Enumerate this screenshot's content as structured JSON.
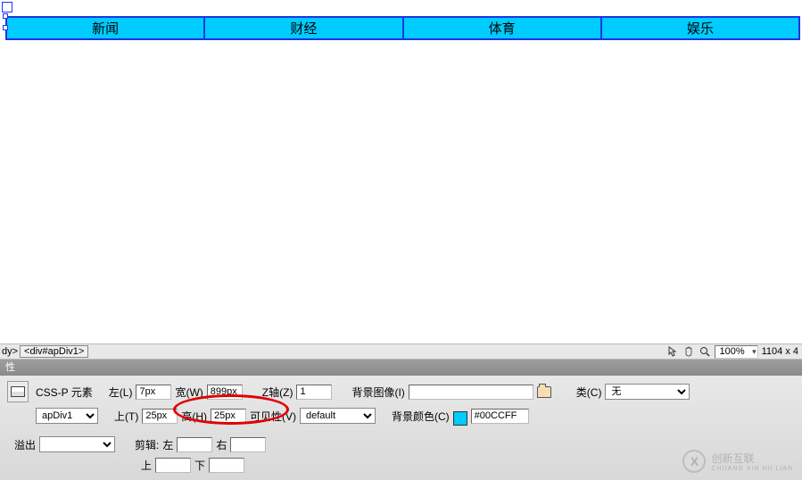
{
  "nav": {
    "items": [
      "新闻",
      "财经",
      "体育",
      "娱乐"
    ]
  },
  "tagbar": {
    "path1": "dy>",
    "path2": "<div#apDiv1>",
    "zoom": "100%",
    "dimensions": "1104 x 4"
  },
  "prop_header": "性",
  "props": {
    "heading": "CSS-P 元素",
    "id_field": "apDiv1",
    "left_label": "左(L)",
    "left_value": "7px",
    "width_label": "宽(W)",
    "width_value": "899px",
    "z_label": "Z轴(Z)",
    "z_value": "1",
    "bgimg_label": "背景图像(I)",
    "bgimg_value": "",
    "class_label": "类(C)",
    "class_value": "无",
    "top_label": "上(T)",
    "top_value": "25px",
    "height_label": "高(H)",
    "height_value": "25px",
    "vis_label": "可见性(V)",
    "vis_value": "default",
    "bgcolor_label": "背景颜色(C)",
    "bgcolor_value": "#00CCFF",
    "overflow_label": "溢出",
    "clip_label": "剪辑:",
    "clip_left": "左",
    "clip_right": "右",
    "clip_top": "上",
    "clip_bottom": "下"
  },
  "watermark": {
    "logo": "X",
    "text": "创新互联",
    "sub": "CHUANG XIN HU LIAN"
  }
}
